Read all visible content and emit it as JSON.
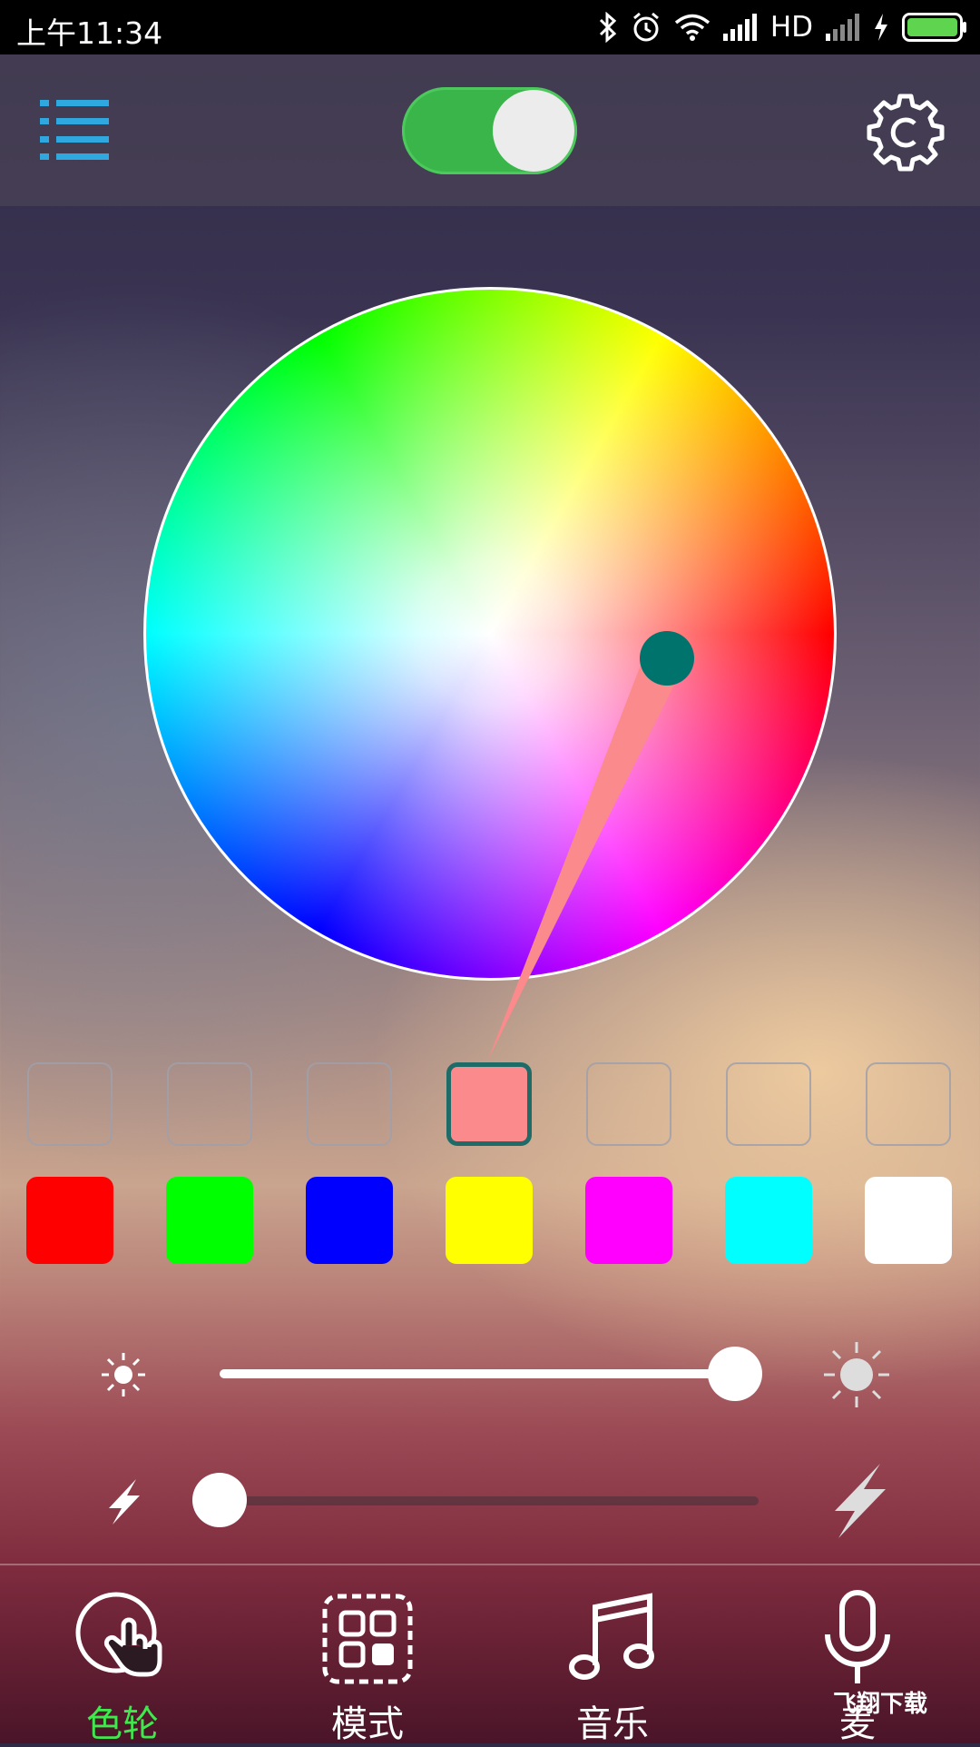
{
  "status_bar": {
    "time": "上午11:34",
    "network": "HD",
    "icons": [
      "bluetooth-icon",
      "alarm-icon",
      "wifi-icon",
      "signal-icon",
      "signal-weak-icon",
      "charging-icon",
      "battery-icon"
    ]
  },
  "header": {
    "menu_icon": "list-menu-icon",
    "power_toggle_on": true,
    "settings_icon": "gear-icon"
  },
  "color_wheel": {
    "selected_color": "#fb8a8c",
    "pointer_color": "#00736c"
  },
  "custom_slots": [
    {
      "color": null
    },
    {
      "color": null
    },
    {
      "color": null
    },
    {
      "color": "#fb8a8c",
      "active": true
    },
    {
      "color": null
    },
    {
      "color": null
    },
    {
      "color": null
    }
  ],
  "preset_colors": [
    "#ff0000",
    "#00ff00",
    "#0000ff",
    "#ffff00",
    "#ff00ff",
    "#00ffff",
    "#ffffff"
  ],
  "brightness": {
    "value": 1.0,
    "min_icon": "sun-small-icon",
    "max_icon": "sun-large-icon"
  },
  "speed": {
    "value": 0.0,
    "min_icon": "lightning-small-icon",
    "max_icon": "lightning-large-icon"
  },
  "bottom_nav": [
    {
      "label": "色轮",
      "icon": "touch-circle-icon",
      "active": true
    },
    {
      "label": "模式",
      "icon": "grid-mode-icon",
      "active": false
    },
    {
      "label": "音乐",
      "icon": "music-note-icon",
      "active": false
    },
    {
      "label": "麦",
      "icon": "microphone-icon",
      "active": false
    }
  ],
  "watermark": "飞翔下载"
}
